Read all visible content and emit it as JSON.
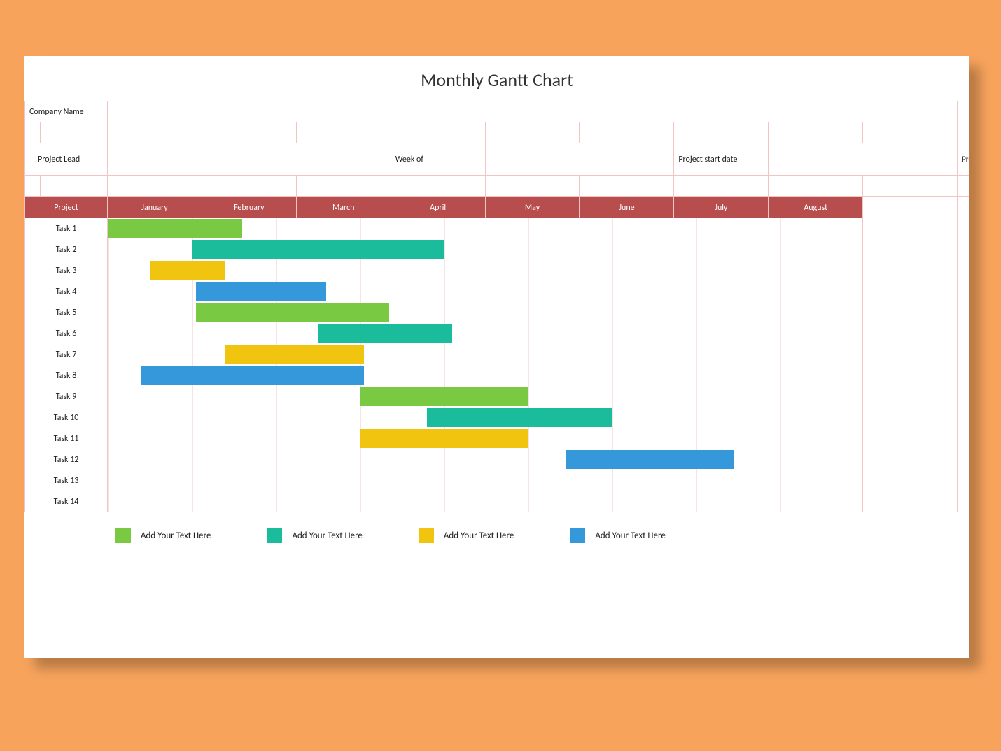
{
  "title": "Monthly Gantt Chart",
  "headers": {
    "company": "Company Name",
    "project_lead": "Project Lead",
    "week_of": "Week of",
    "start_date": "Project start date",
    "end_date": "Project end date",
    "project_col": "Project"
  },
  "months": [
    "January",
    "February",
    "March",
    "April",
    "May",
    "June",
    "July",
    "August"
  ],
  "tasks": [
    {
      "name": "Task 1"
    },
    {
      "name": "Task 2"
    },
    {
      "name": "Task 3"
    },
    {
      "name": "Task 4"
    },
    {
      "name": "Task 5"
    },
    {
      "name": "Task 6"
    },
    {
      "name": "Task 7"
    },
    {
      "name": "Task 8"
    },
    {
      "name": "Task 9"
    },
    {
      "name": "Task 10"
    },
    {
      "name": "Task 11"
    },
    {
      "name": "Task 12"
    },
    {
      "name": "Task 13"
    },
    {
      "name": "Task 14"
    }
  ],
  "bars": [
    {
      "task": 0,
      "color": "green",
      "start": 0.0,
      "end": 1.6
    },
    {
      "task": 1,
      "color": "teal",
      "start": 1.0,
      "end": 4.0
    },
    {
      "task": 2,
      "color": "yellow",
      "start": 0.5,
      "end": 1.4
    },
    {
      "task": 3,
      "color": "blue",
      "start": 1.05,
      "end": 2.6
    },
    {
      "task": 4,
      "color": "green",
      "start": 1.05,
      "end": 3.35
    },
    {
      "task": 5,
      "color": "teal",
      "start": 2.5,
      "end": 4.1
    },
    {
      "task": 6,
      "color": "yellow",
      "start": 1.4,
      "end": 3.05
    },
    {
      "task": 7,
      "color": "blue",
      "start": 0.4,
      "end": 3.05
    },
    {
      "task": 8,
      "color": "green",
      "start": 3.0,
      "end": 5.0
    },
    {
      "task": 9,
      "color": "teal",
      "start": 3.8,
      "end": 6.0
    },
    {
      "task": 10,
      "color": "yellow",
      "start": 3.0,
      "end": 5.0
    },
    {
      "task": 11,
      "color": "blue",
      "start": 5.45,
      "end": 7.45
    }
  ],
  "legend": [
    {
      "color": "green",
      "label": "Add Your Text Here"
    },
    {
      "color": "teal",
      "label": "Add Your Text Here"
    },
    {
      "color": "yellow",
      "label": "Add Your Text Here"
    },
    {
      "color": "blue",
      "label": "Add Your Text Here"
    }
  ],
  "colors": {
    "green": "#7ac943",
    "teal": "#1abc9c",
    "yellow": "#f1c40f",
    "blue": "#3498db",
    "header": "#b74d4d"
  },
  "chart_data": {
    "type": "bar",
    "orientation": "horizontal-gantt",
    "title": "Monthly Gantt Chart",
    "xlabel": "",
    "ylabel": "",
    "x_categories": [
      "January",
      "February",
      "March",
      "April",
      "May",
      "June",
      "July",
      "August"
    ],
    "y_categories": [
      "Task 1",
      "Task 2",
      "Task 3",
      "Task 4",
      "Task 5",
      "Task 6",
      "Task 7",
      "Task 8",
      "Task 9",
      "Task 10",
      "Task 11",
      "Task 12",
      "Task 13",
      "Task 14"
    ],
    "xlim": [
      0,
      8
    ],
    "series": [
      {
        "name": "Add Your Text Here",
        "color": "#7ac943",
        "points": [
          {
            "y": "Task 1",
            "start": 0.0,
            "end": 1.6
          },
          {
            "y": "Task 5",
            "start": 1.05,
            "end": 3.35
          },
          {
            "y": "Task 9",
            "start": 3.0,
            "end": 5.0
          }
        ]
      },
      {
        "name": "Add Your Text Here",
        "color": "#1abc9c",
        "points": [
          {
            "y": "Task 2",
            "start": 1.0,
            "end": 4.0
          },
          {
            "y": "Task 6",
            "start": 2.5,
            "end": 4.1
          },
          {
            "y": "Task 10",
            "start": 3.8,
            "end": 6.0
          }
        ]
      },
      {
        "name": "Add Your Text Here",
        "color": "#f1c40f",
        "points": [
          {
            "y": "Task 3",
            "start": 0.5,
            "end": 1.4
          },
          {
            "y": "Task 7",
            "start": 1.4,
            "end": 3.05
          },
          {
            "y": "Task 11",
            "start": 3.0,
            "end": 5.0
          }
        ]
      },
      {
        "name": "Add Your Text Here",
        "color": "#3498db",
        "points": [
          {
            "y": "Task 4",
            "start": 1.05,
            "end": 2.6
          },
          {
            "y": "Task 8",
            "start": 0.4,
            "end": 3.05
          },
          {
            "y": "Task 12",
            "start": 5.45,
            "end": 7.45
          }
        ]
      }
    ],
    "legend_position": "bottom"
  }
}
